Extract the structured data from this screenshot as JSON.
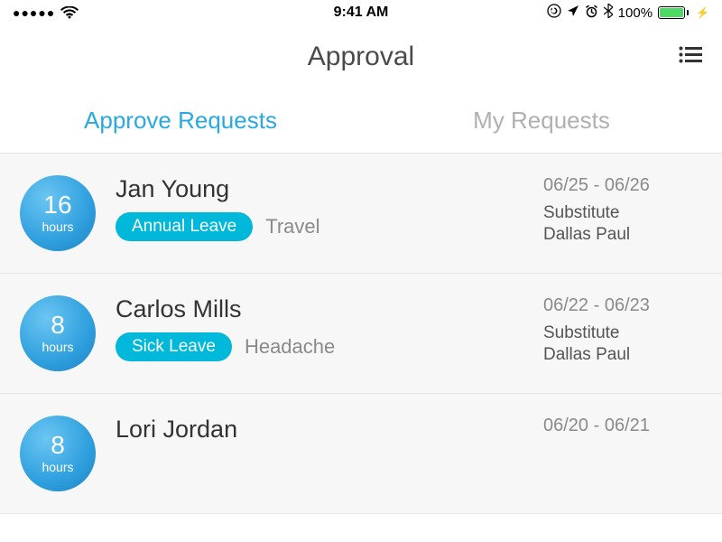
{
  "status": {
    "time": "9:41 AM",
    "battery_pct": "100%"
  },
  "nav": {
    "title": "Approval"
  },
  "tabs": {
    "approve": "Approve Requests",
    "mine": "My Requests"
  },
  "requests": [
    {
      "hours": "16",
      "unit": "hours",
      "name": "Jan Young",
      "type": "Annual Leave",
      "reason": "Travel",
      "dates": "06/25 - 06/26",
      "sub_label": "Substitute",
      "sub_name": "Dallas Paul"
    },
    {
      "hours": "8",
      "unit": "hours",
      "name": "Carlos Mills",
      "type": "Sick Leave",
      "reason": "Headache",
      "dates": "06/22 - 06/23",
      "sub_label": "Substitute",
      "sub_name": "Dallas Paul"
    },
    {
      "hours": "8",
      "unit": "hours",
      "name": "Lori Jordan",
      "type": "",
      "reason": "",
      "dates": "06/20 - 06/21",
      "sub_label": "",
      "sub_name": ""
    }
  ]
}
